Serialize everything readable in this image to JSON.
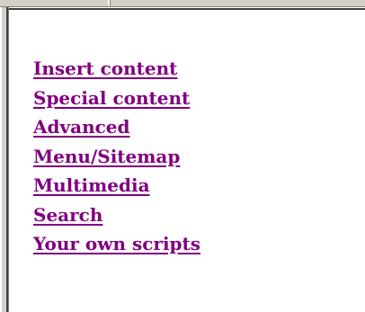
{
  "menu": {
    "items": [
      {
        "id": "insert-content",
        "label": "Insert content"
      },
      {
        "id": "special-content",
        "label": "Special content"
      },
      {
        "id": "advanced",
        "label": "Advanced"
      },
      {
        "id": "menu-sitemap",
        "label": "Menu/Sitemap"
      },
      {
        "id": "multimedia",
        "label": "Multimedia"
      },
      {
        "id": "search",
        "label": "Search"
      },
      {
        "id": "your-own-scripts",
        "label": "Your own scripts"
      }
    ]
  },
  "colors": {
    "link_visited": "#800080",
    "frame_gray": "#d4d0c8",
    "background": "#ffffff"
  }
}
